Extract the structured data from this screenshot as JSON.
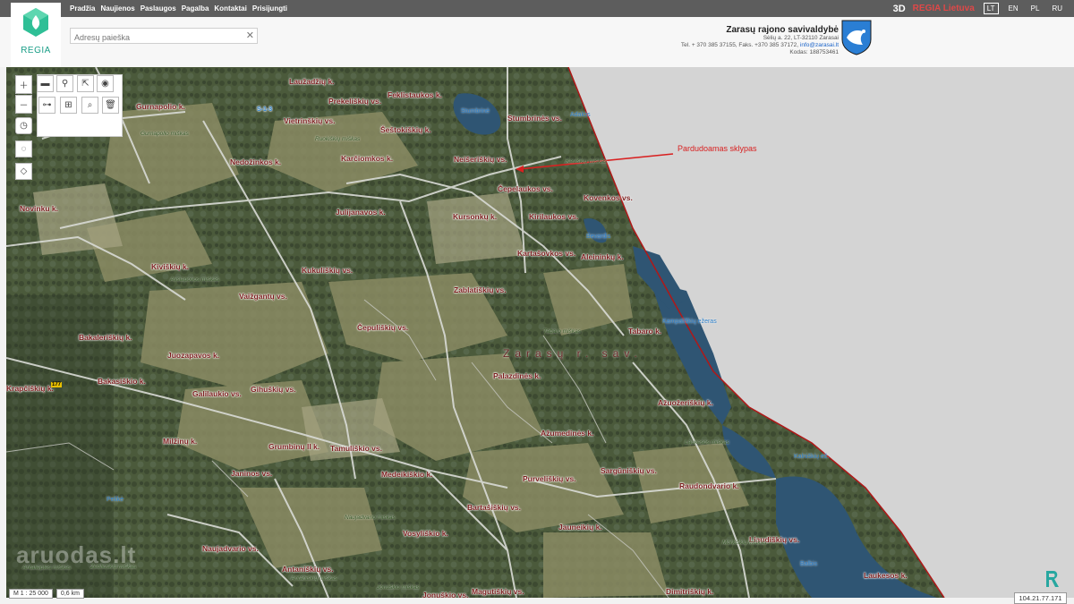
{
  "topbar": {
    "nav": [
      "Pradžia",
      "Naujienos",
      "Paslaugos",
      "Pagalba",
      "Kontaktai",
      "Prisijungti"
    ],
    "btn_3d": "3D",
    "regia_lt": "REGIA Lietuva",
    "languages": [
      "LT",
      "EN",
      "PL",
      "RU"
    ],
    "active_language": "LT"
  },
  "logo": {
    "text": "REGIA"
  },
  "search": {
    "placeholder": "Adresų paieška",
    "clear": "✕"
  },
  "municipality": {
    "name": "Zarasų rajono savivaldybė",
    "address": "Sėlių a. 22, LT-32110 Zarasai",
    "phone": "Tel. + 370 385 37155, Faks. +370 385 37172,",
    "email": "info@zarasai.lt",
    "code": "Kodas: 188753461"
  },
  "map": {
    "annotation": "Pardudoamas sklypas",
    "region": "Zarasų r. sav.",
    "scale": "M 1 : 25 000",
    "distance": "0,6 km",
    "ip": "104.21.77.171",
    "watermark": "aruodas.lt",
    "settlements": [
      {
        "name": "Laužadžių k."
      },
      {
        "name": "Prekeliškių vs."
      },
      {
        "name": "Feklistaukos k."
      },
      {
        "name": "Gurnapolio k."
      },
      {
        "name": "Vietrinškių vs."
      },
      {
        "name": "Šeštokiškių k."
      },
      {
        "name": "Stumbrinės vs."
      },
      {
        "name": "Nedožinkos k."
      },
      {
        "name": "Karčiomkos k."
      },
      {
        "name": "Neišeriškių vs."
      },
      {
        "name": "Čepelaukos vs."
      },
      {
        "name": "Kovenkos vs."
      },
      {
        "name": "Novinku k."
      },
      {
        "name": "Julijanavos k."
      },
      {
        "name": "Kursonkų k."
      },
      {
        "name": "Kirilaukos vs."
      },
      {
        "name": "Kartašovkos vs."
      },
      {
        "name": "Aleininkų k."
      },
      {
        "name": "Kiviškių k."
      },
      {
        "name": "Kukuliškių vs."
      },
      {
        "name": "Vaižgantų vs."
      },
      {
        "name": "Zablatiškių vs."
      },
      {
        "name": "Čepuliškių vs."
      },
      {
        "name": "Tabaro k."
      },
      {
        "name": "Bakaleriškių k."
      },
      {
        "name": "Juozapavos k."
      },
      {
        "name": "Palazdinės k."
      },
      {
        "name": "Krapčiškių k."
      },
      {
        "name": "Bakasiškio k."
      },
      {
        "name": "Galilaukio vs."
      },
      {
        "name": "Gihuškių vs."
      },
      {
        "name": "Ažuožeriškių k."
      },
      {
        "name": "Milžinų k."
      },
      {
        "name": "Ažumedinės k."
      },
      {
        "name": "Grumbinų II k."
      },
      {
        "name": "Tamuliškio vs."
      },
      {
        "name": "Janinos vs."
      },
      {
        "name": "Medeikiškio k."
      },
      {
        "name": "Sargūniškių vs."
      },
      {
        "name": "Purveliškių vs."
      },
      {
        "name": "Raudondvario k."
      },
      {
        "name": "Bartašiškių vs."
      },
      {
        "name": "Naujadvario vs."
      },
      {
        "name": "Vosyliškio k."
      },
      {
        "name": "Jauneikių k."
      },
      {
        "name": "Liaudiškių vs."
      },
      {
        "name": "Antaniškių vs."
      },
      {
        "name": "Jonuškio vs."
      },
      {
        "name": "Magutiškių vs."
      },
      {
        "name": "Dimitriškių k."
      },
      {
        "name": "Laukesos k."
      }
    ],
    "waters": [
      {
        "name": "Stumbrinė"
      },
      {
        "name": "Adalcis"
      },
      {
        "name": "Bevardis"
      },
      {
        "name": "Kampališkių ežeras"
      },
      {
        "name": "Pelikė"
      },
      {
        "name": "Kalniškių ež."
      },
      {
        "name": "Balbis"
      }
    ],
    "forests": [
      {
        "name": "Gurnapolio miškas"
      },
      {
        "name": "Ruokiškių miškas"
      },
      {
        "name": "Kaviškių miškas"
      },
      {
        "name": "Avsiapovos miškas"
      },
      {
        "name": "Tabaro miškas"
      },
      {
        "name": "Laukesos miškas"
      },
      {
        "name": "Naujadvario miškas"
      },
      {
        "name": "Antaniškių miškas"
      },
      {
        "name": "Morkiškių miškas"
      },
      {
        "name": "Jonuškio miškas"
      },
      {
        "name": "Zebliuškių miškas"
      },
      {
        "name": "Antalieptės miškas"
      }
    ],
    "road_ids": [
      "S-1-3",
      "177"
    ]
  }
}
